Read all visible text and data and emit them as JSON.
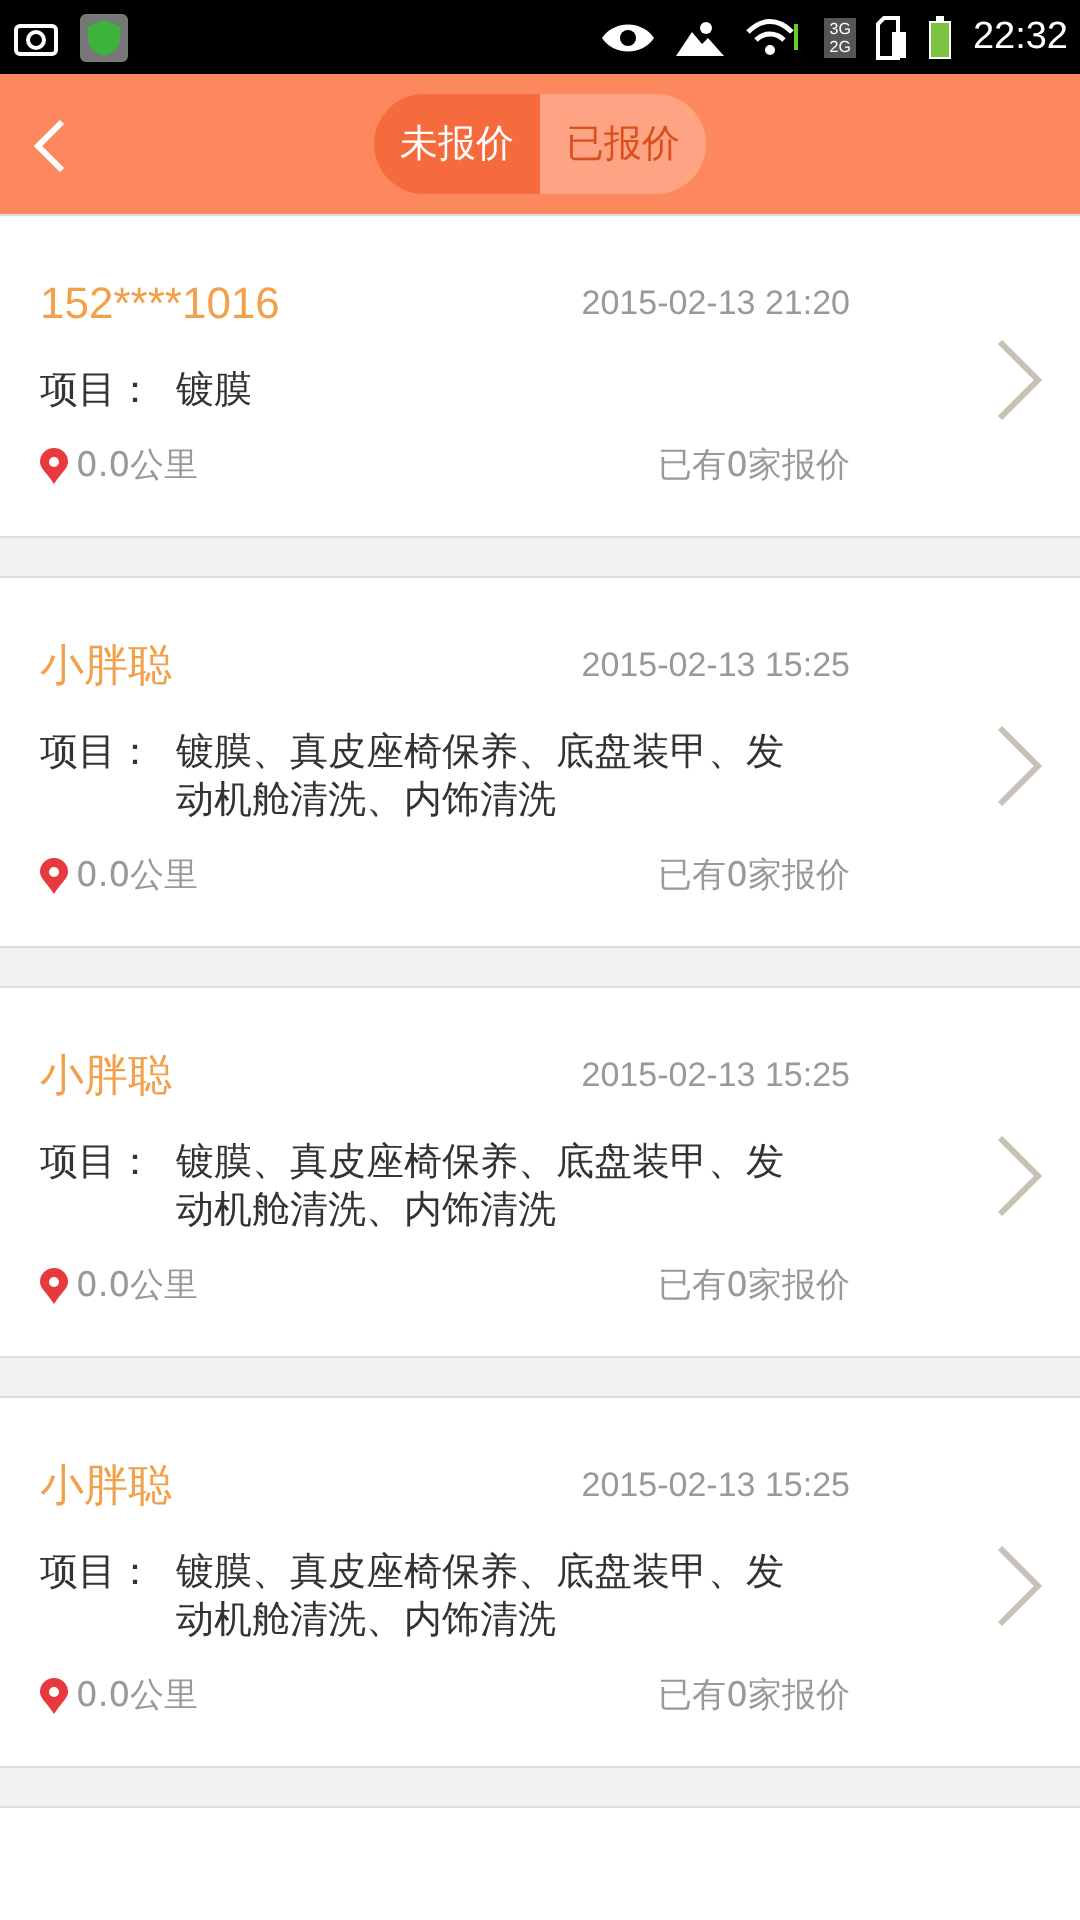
{
  "status_bar": {
    "network_labels": [
      "3G",
      "2G"
    ],
    "time": "22:32"
  },
  "header": {
    "tabs": [
      {
        "label": "未报价",
        "selected": true
      },
      {
        "label": "已报价",
        "selected": false
      }
    ]
  },
  "orders": [
    {
      "name": "152****1016",
      "time": "2015-02-13 21:20",
      "project_label": "项目：",
      "project": "镀膜",
      "distance": "0.0公里",
      "quotes": "已有0家报价"
    },
    {
      "name": "小胖聪",
      "time": "2015-02-13 15:25",
      "project_label": "项目：",
      "project": "镀膜、真皮座椅保养、底盘装甲、发动机舱清洗、内饰清洗",
      "distance": "0.0公里",
      "quotes": "已有0家报价"
    },
    {
      "name": "小胖聪",
      "time": "2015-02-13 15:25",
      "project_label": "项目：",
      "project": "镀膜、真皮座椅保养、底盘装甲、发动机舱清洗、内饰清洗",
      "distance": "0.0公里",
      "quotes": "已有0家报价"
    },
    {
      "name": "小胖聪",
      "time": "2015-02-13 15:25",
      "project_label": "项目：",
      "project": "镀膜、真皮座椅保养、底盘装甲、发动机舱清洗、内饰清洗",
      "distance": "0.0公里",
      "quotes": "已有0家报价"
    }
  ]
}
